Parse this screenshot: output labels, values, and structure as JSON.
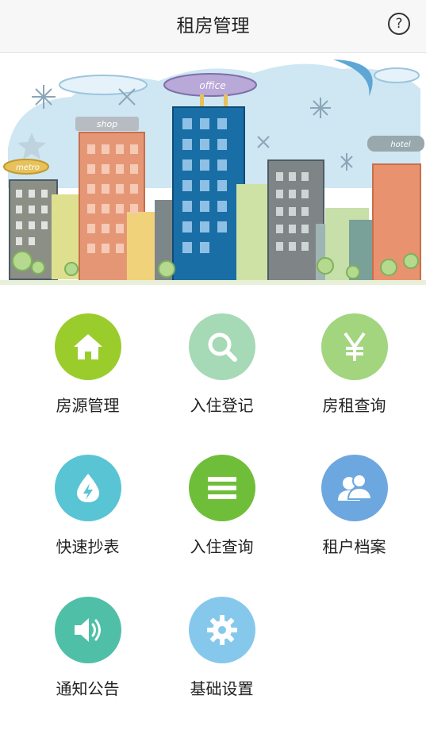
{
  "header": {
    "title": "租房管理",
    "help_label": "?"
  },
  "banner": {
    "signs": [
      "office",
      "shop",
      "metro",
      "hotel"
    ],
    "sign_colors": {
      "office": "#b8a9d8",
      "shop": "#b7bcc2",
      "metro": "#e6c15c",
      "hotel": "#98a8ad"
    }
  },
  "menu": [
    {
      "label": "房源管理",
      "icon": "home-icon",
      "color": "#9acd2c"
    },
    {
      "label": "入住登记",
      "icon": "search-icon",
      "color": "#a6d9b5"
    },
    {
      "label": "房租查询",
      "icon": "yen-icon",
      "color": "#a2d57e"
    },
    {
      "label": "快速抄表",
      "icon": "water-drop-icon",
      "color": "#58c4d4"
    },
    {
      "label": "入住查询",
      "icon": "list-icon",
      "color": "#6fbe39"
    },
    {
      "label": "租户档案",
      "icon": "users-icon",
      "color": "#6da7e0"
    },
    {
      "label": "通知公告",
      "icon": "speaker-icon",
      "color": "#4fc0a7"
    },
    {
      "label": "基础设置",
      "icon": "gear-icon",
      "color": "#85c8ec"
    }
  ]
}
